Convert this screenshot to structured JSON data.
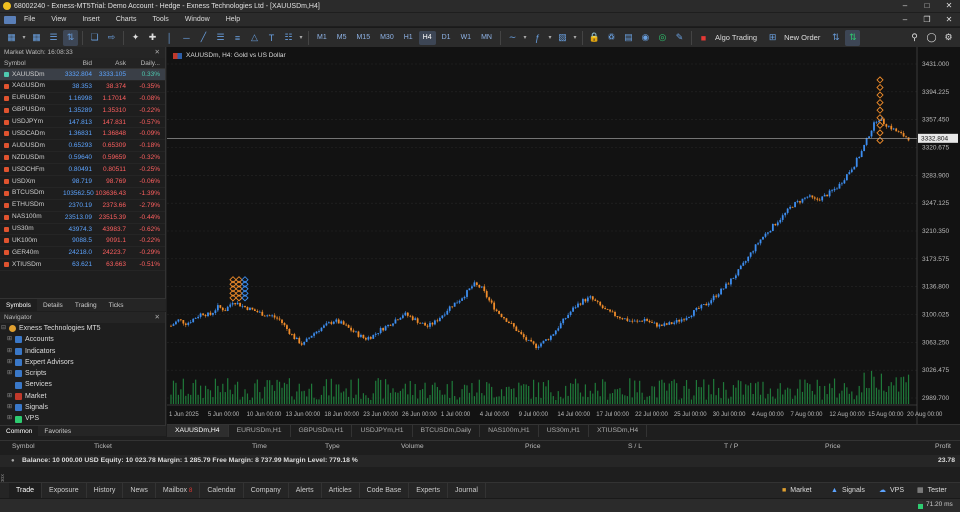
{
  "titlebar": {
    "title": "68002240 - Exness-MT5Trial: Demo Account - Hedge - Exness Technologies Ltd - [XAUUSDm,H4]"
  },
  "menu": [
    "File",
    "View",
    "Insert",
    "Charts",
    "Tools",
    "Window",
    "Help"
  ],
  "toolbar": {
    "timeframes": [
      "M1",
      "M5",
      "M15",
      "M30",
      "H1",
      "H4",
      "D1",
      "W1",
      "MN"
    ],
    "selected_timeframe": "H4",
    "algo_label": "Algo Trading",
    "new_order_label": "New Order"
  },
  "market_watch": {
    "title": "Market Watch: 16:08:33",
    "headers": [
      "Symbol",
      "Bid",
      "Ask",
      "Daily..."
    ],
    "rows": [
      {
        "symbol": "XAUUSDm",
        "bid": "3332.804",
        "ask": "3333.105",
        "daily": "0.33%",
        "up": true
      },
      {
        "symbol": "XAGUSDm",
        "bid": "38.353",
        "ask": "38.374",
        "daily": "-0.35%",
        "up": false
      },
      {
        "symbol": "EURUSDm",
        "bid": "1.16998",
        "ask": "1.17014",
        "daily": "-0.08%",
        "up": false
      },
      {
        "symbol": "GBPUSDm",
        "bid": "1.35289",
        "ask": "1.35310",
        "daily": "-0.22%",
        "up": false
      },
      {
        "symbol": "USDJPYm",
        "bid": "147.813",
        "ask": "147.831",
        "daily": "-0.57%",
        "up": false
      },
      {
        "symbol": "USDCADm",
        "bid": "1.36831",
        "ask": "1.36848",
        "daily": "-0.09%",
        "up": false
      },
      {
        "symbol": "AUDUSDm",
        "bid": "0.65293",
        "ask": "0.65309",
        "daily": "-0.18%",
        "up": false
      },
      {
        "symbol": "NZDUSDm",
        "bid": "0.59640",
        "ask": "0.59659",
        "daily": "-0.32%",
        "up": false
      },
      {
        "symbol": "USDCHFm",
        "bid": "0.80491",
        "ask": "0.80511",
        "daily": "-0.25%",
        "up": false
      },
      {
        "symbol": "USDXm",
        "bid": "98.719",
        "ask": "98.769",
        "daily": "-0.06%",
        "up": false
      },
      {
        "symbol": "BTCUSDm",
        "bid": "103562.50",
        "ask": "103636.43",
        "daily": "-1.39%",
        "up": false
      },
      {
        "symbol": "ETHUSDm",
        "bid": "2370.19",
        "ask": "2373.66",
        "daily": "-2.79%",
        "up": false
      },
      {
        "symbol": "NAS100m",
        "bid": "23513.09",
        "ask": "23515.39",
        "daily": "-0.44%",
        "up": false
      },
      {
        "symbol": "US30m",
        "bid": "43974.3",
        "ask": "43983.7",
        "daily": "-0.62%",
        "up": false
      },
      {
        "symbol": "UK100m",
        "bid": "9088.5",
        "ask": "9091.1",
        "daily": "-0.22%",
        "up": false
      },
      {
        "symbol": "GER40m",
        "bid": "24218.0",
        "ask": "24223.7",
        "daily": "-0.29%",
        "up": false
      },
      {
        "symbol": "XTIUSDm",
        "bid": "63.621",
        "ask": "63.663",
        "daily": "-0.51%",
        "up": false
      }
    ],
    "tabs": [
      "Symbols",
      "Details",
      "Trading",
      "Ticks"
    ]
  },
  "navigator": {
    "title": "Navigator",
    "items": [
      "Exness Technologies MT5",
      "Accounts",
      "Indicators",
      "Expert Advisors",
      "Scripts",
      "Services",
      "Market",
      "Signals",
      "VPS"
    ],
    "tabs": [
      "Common",
      "Favorites"
    ]
  },
  "chart": {
    "header": "XAUUSDm, H4:  Gold vs US Dollar",
    "current_price": "3332.804",
    "price_labels": [
      "3431.000",
      "3394.225",
      "3357.450",
      "3320.675",
      "3283.900",
      "3247.125",
      "3210.350",
      "3173.575",
      "3136.800",
      "3100.025",
      "3063.250",
      "3026.475",
      "2989.700"
    ],
    "date_labels": [
      "1 Jun 2025",
      "5 Jun 00:00",
      "10 Jun 00:00",
      "13 Jun 00:00",
      "18 Jun 00:00",
      "23 Jun 00:00",
      "26 Jun 00:00",
      "1 Jul 00:00",
      "4 Jul 00:00",
      "9 Jul 00:00",
      "14 Jul 00:00",
      "17 Jul 00:00",
      "22 Jul 00:00",
      "25 Jul 00:00",
      "30 Jul 00:00",
      "4 Aug 00:00",
      "7 Aug 00:00",
      "12 Aug 00:00",
      "15 Aug 00:00",
      "20 Aug 00:00"
    ],
    "bull_color": "#3d8ef0",
    "bear_color": "#f08c2a",
    "price_path": [
      3085,
      3093,
      3088,
      3095,
      3102,
      3099,
      3110,
      3106,
      3118,
      3112,
      3108,
      3104,
      3100,
      3098,
      3093,
      3080,
      3068,
      3060,
      3072,
      3080,
      3086,
      3092,
      3088,
      3081,
      3074,
      3068,
      3072,
      3080,
      3086,
      3094,
      3101,
      3096,
      3090,
      3084,
      3090,
      3100,
      3111,
      3118,
      3128,
      3140,
      3135,
      3118,
      3104,
      3095,
      3085,
      3074,
      3064,
      3058,
      3064,
      3072,
      3085,
      3098,
      3110,
      3118,
      3122,
      3114,
      3105,
      3100,
      3096,
      3092,
      3090,
      3094,
      3088,
      3085,
      3087,
      3090,
      3095,
      3101,
      3108,
      3114,
      3124,
      3133,
      3144,
      3156,
      3170,
      3186,
      3200,
      3211,
      3222,
      3232,
      3244,
      3250,
      3256,
      3251,
      3255,
      3262,
      3270,
      3284,
      3298,
      3316,
      3340,
      3360,
      3352,
      3345,
      3338,
      3333
    ]
  },
  "chart_tabs": [
    "XAUUSDm,H4",
    "EURUSDm,H1",
    "GBPUSDm,H1",
    "USDJPYm,H1",
    "BTCUSDm,Daily",
    "NAS100m,H1",
    "US30m,H1",
    "XTIUSDm,H4"
  ],
  "trade": {
    "headers": [
      "Symbol",
      "Ticket",
      "Time",
      "Type",
      "Volume",
      "Price",
      "S / L",
      "T / P",
      "Price",
      "Profit"
    ],
    "balance_line": "Balance: 10 000.00 USD   Equity: 10 023.78   Margin: 1 285.79   Free Margin: 8 737.99   Margin Level: 779.18 %",
    "profit": "23.78"
  },
  "toolbox_label": "Toolbox",
  "bottom_tabs": [
    "Trade",
    "Exposure",
    "History",
    "News",
    "Mailbox",
    "Calendar",
    "Company",
    "Alerts",
    "Articles",
    "Code Base",
    "Experts",
    "Journal"
  ],
  "mailbox_badge": "8",
  "bottom_right": [
    "Market",
    "Signals",
    "VPS",
    "Tester"
  ],
  "status": {
    "ping": "71.20 ms"
  }
}
